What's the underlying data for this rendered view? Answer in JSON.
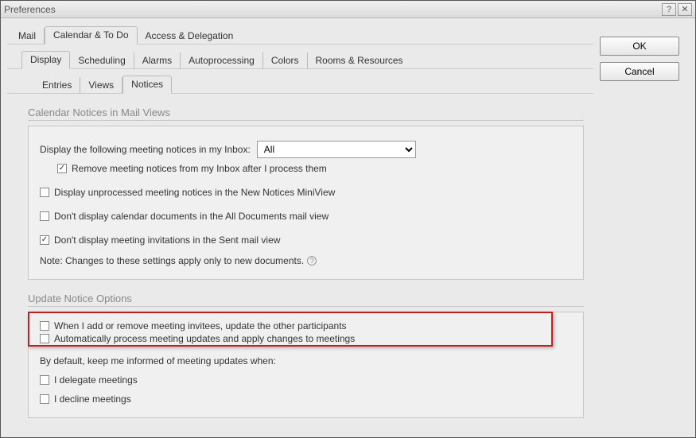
{
  "window": {
    "title": "Preferences"
  },
  "buttons": {
    "ok": "OK",
    "cancel": "Cancel",
    "help": "?",
    "close": "✕"
  },
  "tabs_top": [
    {
      "label": "Mail",
      "active": false
    },
    {
      "label": "Calendar & To Do",
      "active": true
    },
    {
      "label": "Access & Delegation",
      "active": false
    }
  ],
  "tabs_sub1": [
    {
      "label": "Display",
      "active": true
    },
    {
      "label": "Scheduling",
      "active": false
    },
    {
      "label": "Alarms",
      "active": false
    },
    {
      "label": "Autoprocessing",
      "active": false
    },
    {
      "label": "Colors",
      "active": false
    },
    {
      "label": "Rooms & Resources",
      "active": false
    }
  ],
  "tabs_sub2": [
    {
      "label": "Entries",
      "active": false
    },
    {
      "label": "Views",
      "active": false
    },
    {
      "label": "Notices",
      "active": true
    }
  ],
  "section1": {
    "title": "Calendar Notices in Mail Views",
    "inbox_label": "Display the following meeting notices in my Inbox:",
    "inbox_select": "All",
    "inbox_options": [
      "All"
    ],
    "remove_after": {
      "checked": true,
      "label": "Remove meeting notices from my Inbox after I process them"
    },
    "unprocessed": {
      "checked": false,
      "label": "Display unprocessed meeting notices in the New Notices MiniView"
    },
    "dont_all_docs": {
      "checked": false,
      "label": "Don't display calendar documents in the All Documents mail view"
    },
    "dont_sent": {
      "checked": true,
      "label": "Don't display meeting invitations in the Sent mail view"
    },
    "note": "Note:  Changes to these settings apply only to new documents."
  },
  "section2": {
    "title": "Update Notice Options",
    "update_participants": {
      "checked": false,
      "label": "When I add or remove meeting invitees, update the other participants"
    },
    "auto_process": {
      "checked": false,
      "label": "Automatically process meeting updates and apply changes to meetings"
    },
    "by_default": "By default, keep me informed of meeting updates when:",
    "delegate": {
      "checked": false,
      "label": "I delegate meetings"
    },
    "decline": {
      "checked": false,
      "label": "I decline meetings"
    }
  }
}
